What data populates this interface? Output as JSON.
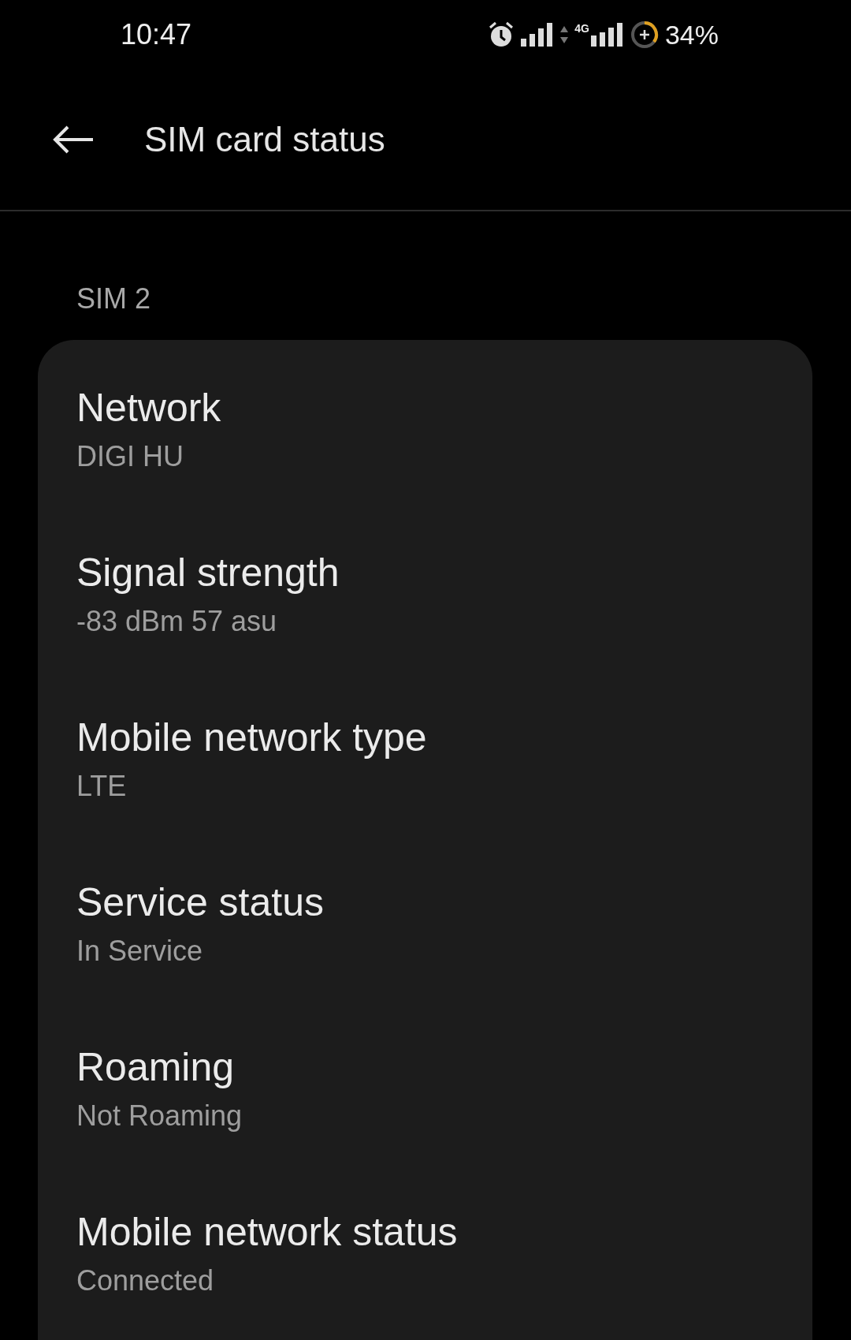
{
  "status_bar": {
    "time": "10:47",
    "network_label": "4G",
    "battery": "34%"
  },
  "app_bar": {
    "title": "SIM card status"
  },
  "section": {
    "title": "SIM 2"
  },
  "items": [
    {
      "title": "Network",
      "value": "DIGI HU"
    },
    {
      "title": "Signal strength",
      "value": "-83 dBm 57 asu"
    },
    {
      "title": "Mobile network type",
      "value": "LTE"
    },
    {
      "title": "Service status",
      "value": "In Service"
    },
    {
      "title": "Roaming",
      "value": "Not Roaming"
    },
    {
      "title": "Mobile network status",
      "value": "Connected"
    }
  ]
}
